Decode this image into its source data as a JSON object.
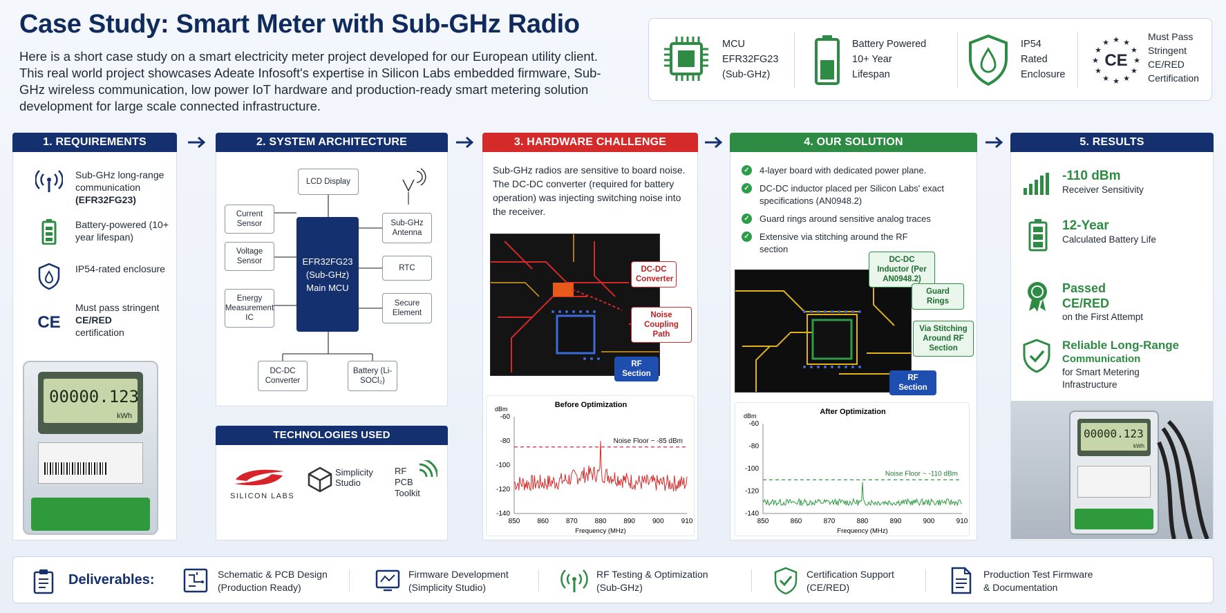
{
  "header": {
    "title": "Case Study: Smart Meter with Sub-GHz Radio",
    "intro": "Here is a short case study on a smart electricity meter project developed for our European utility client. This real world project showcases Adeate Infosoft's expertise in Silicon Labs embedded firmware, Sub-GHz wireless communication, low power IoT hardware and production-ready smart metering solution development for large scale connected infrastructure."
  },
  "specs": [
    {
      "icon": "chip-icon",
      "lines": [
        "MCU",
        "EFR32FG23",
        "(Sub-GHz)"
      ]
    },
    {
      "icon": "battery-icon",
      "lines": [
        "Battery Powered",
        "10+ Year",
        "Lifespan"
      ]
    },
    {
      "icon": "water-shield-icon",
      "lines": [
        "IP54",
        "Rated",
        "Enclosure"
      ]
    },
    {
      "icon": "ce-stars-icon",
      "lines": [
        "Must Pass",
        "Stringent",
        "CE/RED",
        "Certification"
      ]
    }
  ],
  "sections": {
    "requirements": {
      "title": "1. REQUIREMENTS",
      "items": [
        {
          "icon": "antenna-icon",
          "text": "Sub-GHz long-range communication",
          "bold": "(EFR32FG23)"
        },
        {
          "icon": "battery-icon",
          "text": "Battery-powered (10+ year lifespan)",
          "bold": ""
        },
        {
          "icon": "water-drop-shield-icon",
          "text": "IP54-rated enclosure",
          "bold": ""
        },
        {
          "icon": "ce-mark-icon",
          "text": "Must pass stringent",
          "bold": "CE/RED",
          "text2": "certification"
        }
      ],
      "meter_display": "00000.123",
      "meter_unit": "kWh"
    },
    "architecture": {
      "title": "2. SYSTEM ARCHITECTURE",
      "mcu": [
        "EFR32FG23",
        "(Sub-GHz)",
        "Main MCU"
      ],
      "blocks": {
        "lcd": "LCD Display",
        "current": "Current Sensor",
        "voltage": "Voltage Sensor",
        "energy": "Energy Measurement IC",
        "antenna": "Sub-GHz Antenna",
        "rtc": "RTC",
        "secure": "Secure Element",
        "dcdc": "DC-DC Converter",
        "battery": "Battery (Li-SOCl₂)"
      }
    },
    "technologies": {
      "title": "TECHNOLOGIES USED",
      "silicon_labs": "SILICON LABS",
      "simplicity": "Simplicity Studio",
      "rf": [
        "RF",
        "PCB",
        "Toolkit"
      ]
    },
    "challenge": {
      "title": "3. HARDWARE CHALLENGE",
      "text": "Sub-GHz radios are sensitive to board noise. The DC-DC converter (required for battery operation) was injecting switching noise into the receiver.",
      "tags": {
        "dcdc": "DC-DC Converter",
        "noise": "Noise Coupling Path",
        "rf": "RF Section"
      }
    },
    "solution": {
      "title": "4. OUR SOLUTION",
      "items": [
        "4-layer board with dedicated power plane.",
        "DC-DC inductor placed per Silicon Labs' exact specifications (AN0948.2)",
        "Guard rings around sensitive analog traces",
        "Extensive via stitching around the RF section"
      ],
      "tags": {
        "inductor": "DC-DC Inductor (Per AN0948.2)",
        "guard": "Guard Rings",
        "via": "Via Stitching Around RF Section",
        "rf": "RF Section"
      }
    },
    "results": {
      "title": "5. RESULTS",
      "items": [
        {
          "icon": "signal-bars-icon",
          "big": "-110 dBm",
          "small": "Receiver Sensitivity"
        },
        {
          "icon": "battery-full-icon",
          "big": "12-Year",
          "small": "Calculated Battery Life"
        },
        {
          "icon": "award-ribbon-icon",
          "big": "Passed CE/RED",
          "small": "on the First Attempt"
        },
        {
          "icon": "shield-check-icon",
          "big": "Reliable Long-Range",
          "big2": "Communication",
          "small": "for Smart Metering Infrastructure"
        }
      ],
      "meter_display": "00000.123",
      "meter_unit": "kWh"
    }
  },
  "chart_data": [
    {
      "type": "line",
      "title": "Before Optimization",
      "xlabel": "Frequency (MHz)",
      "ylabel": "dBm",
      "xlim": [
        850,
        910
      ],
      "ylim": [
        -140,
        -60
      ],
      "xticks": [
        850,
        860,
        870,
        880,
        890,
        900,
        910
      ],
      "yticks": [
        -60,
        -80,
        -100,
        -120,
        -140
      ],
      "noise_floor": -85,
      "noise_floor_label": "Noise Floor ~ -85 dBm",
      "baseline": -115,
      "spur": {
        "x": 880,
        "y": -80
      },
      "color": "#d42a2a"
    },
    {
      "type": "line",
      "title": "After Optimization",
      "xlabel": "Frequency (MHz)",
      "ylabel": "dBm",
      "xlim": [
        850,
        910
      ],
      "ylim": [
        -140,
        -60
      ],
      "xticks": [
        850,
        860,
        870,
        880,
        890,
        900,
        910
      ],
      "yticks": [
        -60,
        -80,
        -100,
        -120,
        -140
      ],
      "noise_floor": -110,
      "noise_floor_label": "Noise Floor ~ -110 dBm",
      "baseline": -130,
      "spur": {
        "x": 880,
        "y": -112
      },
      "color": "#2b9a3e"
    }
  ],
  "deliverables": {
    "label": "Deliverables:",
    "items": [
      {
        "icon": "pcb-schematic-icon",
        "lines": [
          "Schematic & PCB Design",
          "(Production Ready)"
        ]
      },
      {
        "icon": "firmware-icon",
        "lines": [
          "Firmware Development",
          "(Simplicity Studio)"
        ]
      },
      {
        "icon": "rf-signal-icon",
        "lines": [
          "RF Testing & Optimization",
          "(Sub-GHz)"
        ]
      },
      {
        "icon": "cert-shield-icon",
        "lines": [
          "Certification Support",
          "(CE/RED)"
        ]
      },
      {
        "icon": "document-icon",
        "lines": [
          "Production Test Firmware",
          "& Documentation"
        ]
      }
    ]
  },
  "colors": {
    "navy": "#14306e",
    "red": "#d42a2a",
    "green": "#2e8b43"
  }
}
